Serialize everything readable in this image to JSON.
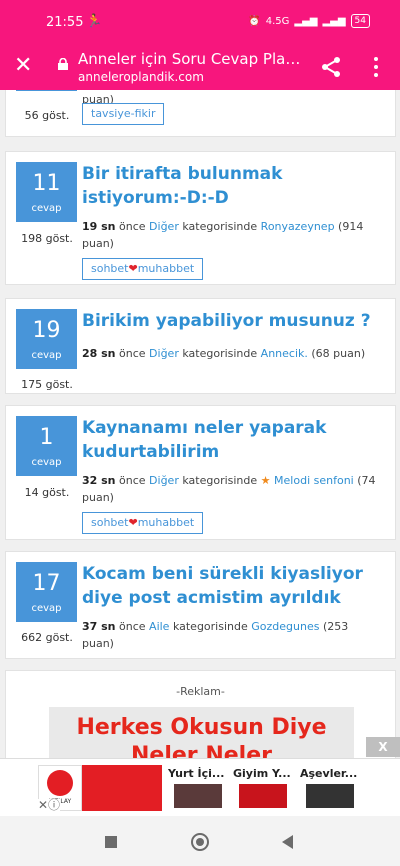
{
  "status_bar": {
    "time": "21:55",
    "network": "4.5G",
    "battery": "54"
  },
  "browser": {
    "title": "Anneler için Soru Cevap Platf...",
    "url": "anneleroplandik.com"
  },
  "partial_card": {
    "meta_tail": "puan)",
    "views": "56 göst.",
    "tag": "tavsiye-fikir"
  },
  "questions": [
    {
      "answers": "11",
      "answers_label": "cevap",
      "views": "198 göst.",
      "title": "Bir itirafta bulunmak istiyorum:-D:-D",
      "time": "19 sn",
      "ago": "önce",
      "category": "Diğer",
      "in_category": "kategorisinde",
      "user": "Ronyazeynep",
      "points": "(914 puan)",
      "tag_left": "sohbet",
      "tag_right": "muhabbet"
    },
    {
      "answers": "19",
      "answers_label": "cevap",
      "views": "175 göst.",
      "title": "Birikim yapabiliyor musunuz ?",
      "time": "28 sn",
      "ago": "önce",
      "category": "Diğer",
      "in_category": "kategorisinde",
      "user": "Annecik.",
      "points": "(68 puan)"
    },
    {
      "answers": "1",
      "answers_label": "cevap",
      "views": "14 göst.",
      "title": "Kaynanamı neler yaparak kudurtabilirim",
      "time": "32 sn",
      "ago": "önce",
      "category": "Diğer",
      "in_category": "kategorisinde",
      "user": "Melodi senfoni",
      "points": "(74 puan)",
      "tag_left": "sohbet",
      "tag_right": "muhabbet"
    },
    {
      "answers": "17",
      "answers_label": "cevap",
      "views": "662 göst.",
      "title": "Kocam beni sürekli kiyasliyor diye post acmistim ayrıldık",
      "time": "37 sn",
      "ago": "önce",
      "category": "Aile",
      "in_category": "kategorisinde",
      "user": "Gozdegunes",
      "points": "(253 puan)"
    }
  ],
  "ad": {
    "label": "-Reklam-",
    "banner_line1": "Herkes Okusun Diye",
    "banner_line2": "Neler Neler",
    "close": "X"
  },
  "bottom_ad": {
    "logo_text": "KIZILAY",
    "items": [
      "Yurt İçi...",
      "Giyim Y...",
      "Aşevler..."
    ]
  },
  "colors": {
    "brand": "#f7167d",
    "accent": "#4895d9",
    "title": "#2f8fd2"
  }
}
